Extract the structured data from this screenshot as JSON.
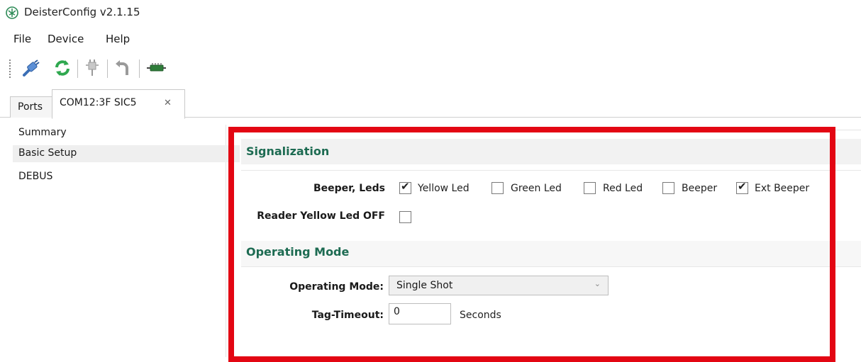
{
  "window": {
    "title": "DeisterConfig v2.1.15"
  },
  "menu": {
    "items": [
      "File",
      "Device",
      "Help"
    ]
  },
  "toolbar": {
    "icons": [
      "connect-icon",
      "refresh-icon",
      "disconnect-icon",
      "undo-icon",
      "device-icon"
    ]
  },
  "tabs": [
    {
      "label": "Ports"
    },
    {
      "label": "COM12:3F SIC5",
      "close": "✕"
    }
  ],
  "sidebar": {
    "items": [
      {
        "label": "Summary",
        "selected": false
      },
      {
        "label": "Basic Setup",
        "selected": true
      },
      {
        "label": "DEBUS",
        "selected": false
      }
    ]
  },
  "signalization": {
    "title": "Signalization",
    "beeper_leds_label": "Beeper, Leds",
    "options": [
      {
        "label": "Yellow Led",
        "checked": true
      },
      {
        "label": "Green Led",
        "checked": false
      },
      {
        "label": "Red Led",
        "checked": false
      },
      {
        "label": "Beeper",
        "checked": false
      },
      {
        "label": "Ext Beeper",
        "checked": true
      }
    ],
    "reader_yellow_label": "Reader Yellow Led OFF",
    "reader_yellow_checked": false
  },
  "operating_mode": {
    "title": "Operating Mode",
    "mode_label": "Operating Mode:",
    "mode_value": "Single Shot",
    "timeout_label": "Tag-Timeout:",
    "timeout_value": "0",
    "timeout_units": "Seconds"
  },
  "colors": {
    "section_title": "#1d6b52",
    "highlight": "#e30613"
  }
}
